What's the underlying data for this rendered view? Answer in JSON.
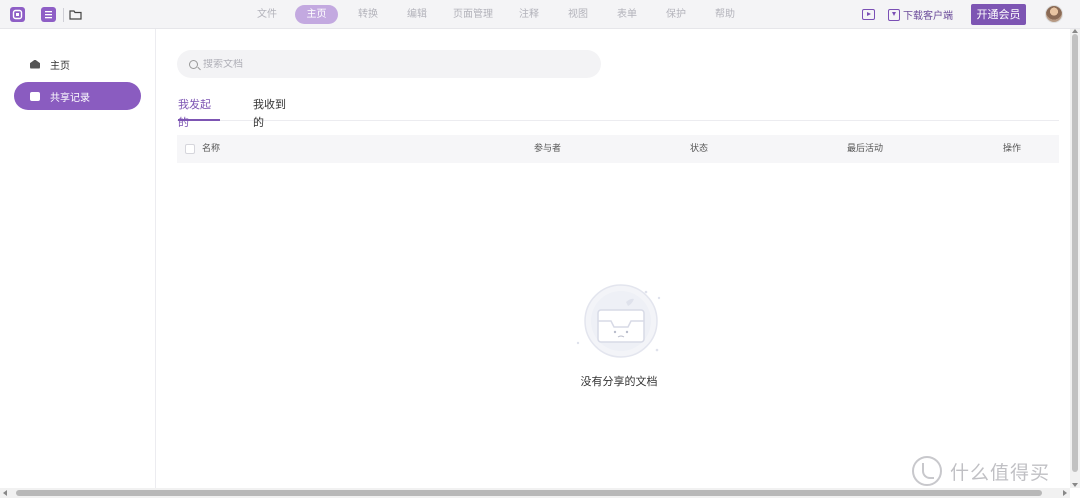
{
  "toolbar": {
    "menu": [
      {
        "label": "文件",
        "active": false
      },
      {
        "label": "主页",
        "active": true
      },
      {
        "label": "转换",
        "active": false
      },
      {
        "label": "编辑",
        "active": false
      },
      {
        "label": "页面管理",
        "active": false
      },
      {
        "label": "注释",
        "active": false
      },
      {
        "label": "视图",
        "active": false
      },
      {
        "label": "表单",
        "active": false
      },
      {
        "label": "保护",
        "active": false
      },
      {
        "label": "帮助",
        "active": false
      }
    ],
    "download_label": "下载客户端",
    "vip_label": "开通会员",
    "accent_color": "#7d55b3"
  },
  "sidebar": {
    "items": [
      {
        "label": "主页",
        "icon": "home-icon",
        "active": false
      },
      {
        "label": "共享记录",
        "icon": "document-icon",
        "active": true
      }
    ]
  },
  "main": {
    "search": {
      "placeholder": "搜索文档",
      "value": ""
    },
    "tabs": [
      {
        "label": "我发起的",
        "active": true
      },
      {
        "label": "我收到的",
        "active": false
      }
    ],
    "table": {
      "columns": [
        "名称",
        "参与者",
        "状态",
        "最后活动",
        "操作"
      ],
      "rows": []
    },
    "empty_text": "没有分享的文档"
  },
  "watermark": {
    "text": "什么值得买"
  }
}
